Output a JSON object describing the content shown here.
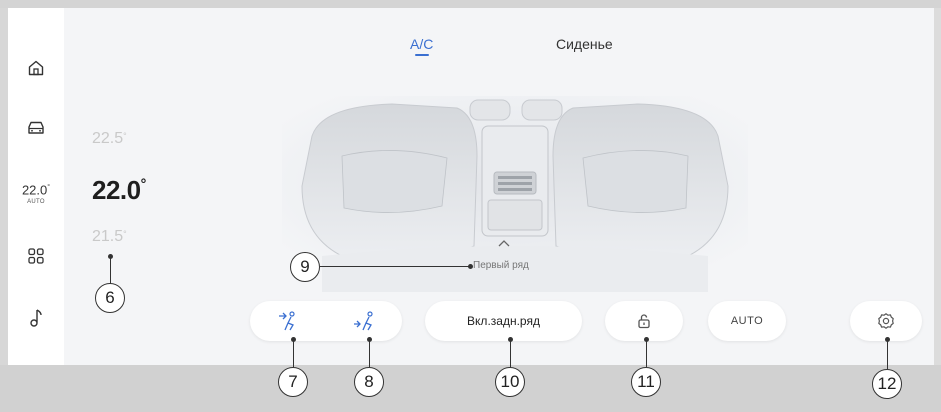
{
  "tabs": {
    "ac": "A/C",
    "seat": "Сиденье"
  },
  "sidebar": {
    "items": [
      {
        "icon": "home-icon"
      },
      {
        "icon": "car-icon"
      },
      {
        "icon": "temperature-widget",
        "temp": "22.0",
        "mode": "AUTO"
      },
      {
        "icon": "apps-grid-icon"
      },
      {
        "icon": "music-note-icon"
      }
    ]
  },
  "temperature": {
    "upper": "22.5",
    "current": "22.0",
    "lower": "21.5",
    "unit": "°"
  },
  "rear_row_label": "Первый ряд",
  "controls": {
    "airflow_upper_icon": "airflow-upper-body-icon",
    "airflow_lower_icon": "airflow-feet-icon",
    "rear_row_button": "Вкл.задн.ряд",
    "lock_icon": "unlock-icon",
    "auto_button": "AUTO",
    "settings_icon": "gear-icon"
  },
  "callouts": {
    "c6": "6",
    "c7": "7",
    "c8": "8",
    "c9": "9",
    "c10": "10",
    "c11": "11",
    "c12": "12"
  },
  "colors": {
    "accent": "#3a6fd1",
    "background": "#f4f5f7",
    "frame": "#d1d1d1"
  }
}
